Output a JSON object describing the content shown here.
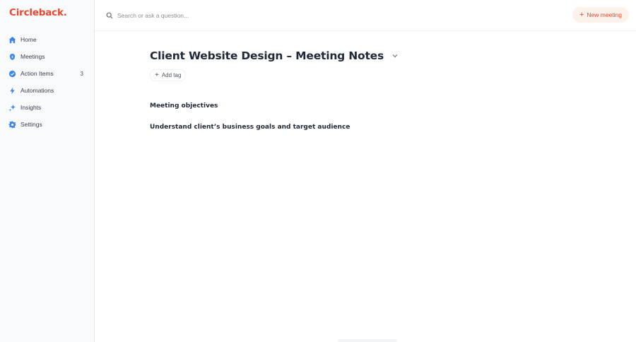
{
  "app": {
    "logo_text": "Circleback",
    "logo_dot": ".",
    "brand_color": "#e8482f"
  },
  "sidebar": {
    "items": [
      {
        "label": "Home",
        "icon": "home-icon"
      },
      {
        "label": "Meetings",
        "icon": "meetings-icon"
      },
      {
        "label": "Action Items",
        "icon": "action-items-icon",
        "badge": "3"
      },
      {
        "label": "Automations",
        "icon": "lightning-icon"
      },
      {
        "label": "Insights",
        "icon": "sparkles-icon"
      },
      {
        "label": "Settings",
        "icon": "gear-icon"
      }
    ]
  },
  "topbar": {
    "search_placeholder": "Search or ask a question...",
    "new_meeting_label": "New meeting"
  },
  "meeting": {
    "title": "Client Website Design – Meeting Notes",
    "add_tag_label": "Add tag",
    "section_heading": "Meeting objectives",
    "section_item": "Understand client’s business goals and target audience"
  }
}
